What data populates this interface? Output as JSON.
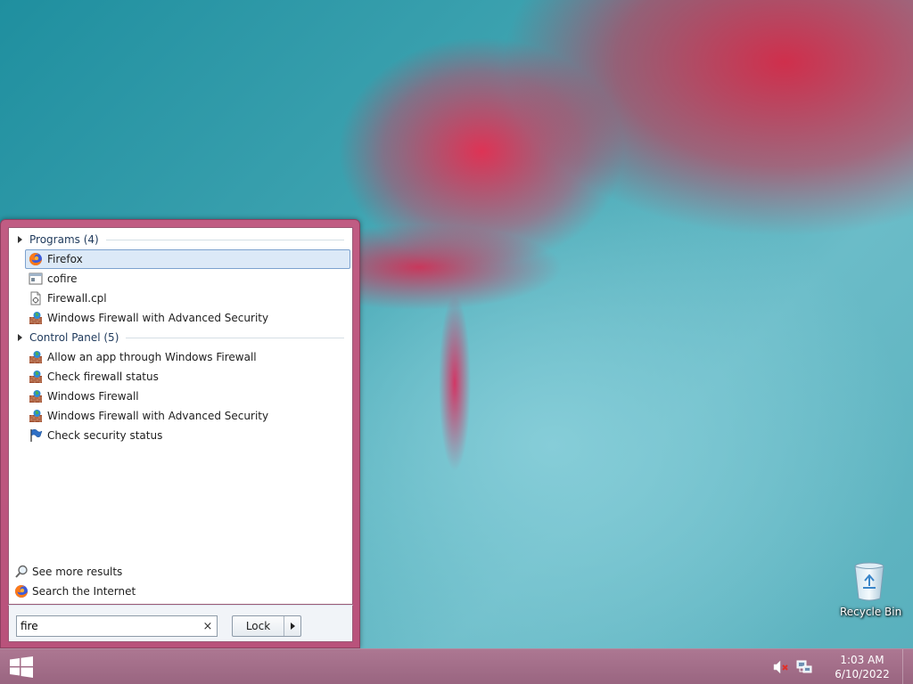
{
  "desktop": {
    "icons": [
      {
        "label": "Recycle Bin",
        "icon": "recycle-bin-icon"
      }
    ]
  },
  "start_menu": {
    "groups": [
      {
        "header": "Programs (4)",
        "items": [
          {
            "label": "Firefox",
            "icon": "firefox-icon",
            "selected": true
          },
          {
            "label": "cofire",
            "icon": "application-window-icon"
          },
          {
            "label": "Firewall.cpl",
            "icon": "control-panel-file-icon"
          },
          {
            "label": "Windows Firewall with Advanced Security",
            "icon": "firewall-icon"
          }
        ]
      },
      {
        "header": "Control Panel (5)",
        "items": [
          {
            "label": "Allow an app through Windows Firewall",
            "icon": "firewall-icon"
          },
          {
            "label": "Check firewall status",
            "icon": "firewall-icon"
          },
          {
            "label": "Windows Firewall",
            "icon": "firewall-icon"
          },
          {
            "label": "Windows Firewall with Advanced Security",
            "icon": "firewall-icon"
          },
          {
            "label": "Check security status",
            "icon": "action-center-flag-icon"
          }
        ]
      }
    ],
    "footer_links": [
      {
        "label": "See more results",
        "icon": "search-icon"
      },
      {
        "label": "Search the Internet",
        "icon": "firefox-icon"
      }
    ],
    "search": {
      "value": "fire",
      "clear_glyph": "×"
    },
    "power_button": {
      "label": "Lock"
    }
  },
  "taskbar": {
    "start_icon": "windows-logo-icon",
    "tray_icons": [
      "volume-muted-icon",
      "network-icon"
    ],
    "clock": {
      "time": "1:03 AM",
      "date": "6/10/2022"
    }
  },
  "colors": {
    "start_menu_frame": "#c05c83",
    "selection": "#dce9f7",
    "selection_border": "#7da2ce",
    "group_header_text": "#1e395b"
  }
}
